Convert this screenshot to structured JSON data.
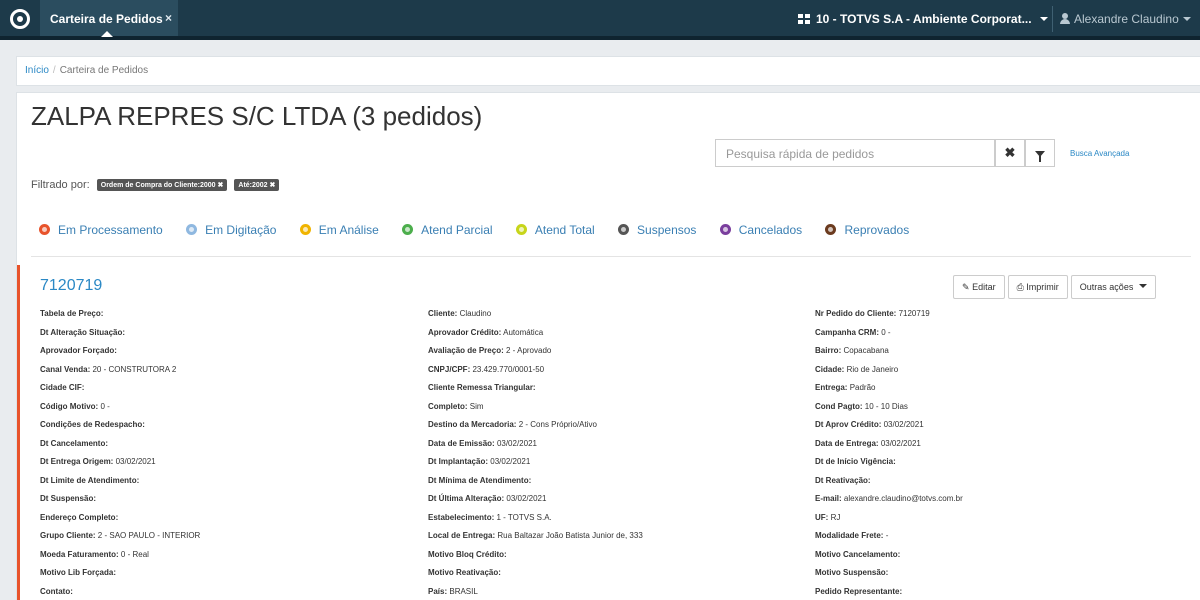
{
  "topbar": {
    "tab_label": "Carteira de Pedidos",
    "tab_close": "×",
    "company": "10 - TOTVS S.A - Ambiente Corporat...",
    "user": "Alexandre Claudino"
  },
  "breadcrumb": {
    "home": "Início",
    "separator": "/",
    "current": "Carteira de Pedidos"
  },
  "page": {
    "title": "ZALPA REPRES S/C LTDA (3 pedidos)",
    "search_placeholder": "Pesquisa rápida de pedidos",
    "clear_icon": "✖",
    "advanced_search": "Busca Avançada",
    "filter_label": "Filtrado por:",
    "filters": [
      "Ordem de Compra do Cliente:2000 ✖",
      "Até:2002 ✖"
    ]
  },
  "legend": [
    {
      "label": "Em Processamento",
      "color": "#e8532b"
    },
    {
      "label": "Em Digitação",
      "color": "#8fb8e0"
    },
    {
      "label": "Em Análise",
      "color": "#f0b400"
    },
    {
      "label": "Atend Parcial",
      "color": "#4cae4c"
    },
    {
      "label": "Atend Total",
      "color": "#c7d51a"
    },
    {
      "label": "Suspensos",
      "color": "#555555"
    },
    {
      "label": "Cancelados",
      "color": "#7a3e9d"
    },
    {
      "label": "Reprovados",
      "color": "#6b3b1f"
    }
  ],
  "order": {
    "id": "7120719",
    "edit_label": "Editar",
    "print_label": "Imprimir",
    "more_label": "Outras ações",
    "col1": [
      {
        "label": "Tabela de Preço:",
        "value": ""
      },
      {
        "label": "Dt Alteração Situação:",
        "value": ""
      },
      {
        "label": "Aprovador Forçado:",
        "value": ""
      },
      {
        "label": "Canal Venda:",
        "value": "20 - CONSTRUTORA 2"
      },
      {
        "label": "Cidade CIF:",
        "value": ""
      },
      {
        "label": "Código Motivo:",
        "value": "0 -"
      },
      {
        "label": "Condições de Redespacho:",
        "value": ""
      },
      {
        "label": "Dt Cancelamento:",
        "value": ""
      },
      {
        "label": "Dt Entrega Origem:",
        "value": "03/02/2021"
      },
      {
        "label": "Dt Limite de Atendimento:",
        "value": ""
      },
      {
        "label": "Dt Suspensão:",
        "value": ""
      },
      {
        "label": "Endereço Completo:",
        "value": ""
      },
      {
        "label": "Grupo Cliente:",
        "value": "2 - SAO PAULO - INTERIOR"
      },
      {
        "label": "Moeda Faturamento:",
        "value": "0 - Real"
      },
      {
        "label": "Motivo Lib Forçada:",
        "value": ""
      },
      {
        "label": "Contato:",
        "value": ""
      }
    ],
    "col2": [
      {
        "label": "Cliente:",
        "value": "Claudino"
      },
      {
        "label": "Aprovador Crédito:",
        "value": "Automática"
      },
      {
        "label": "Avaliação de Preço:",
        "value": "2 - Aprovado"
      },
      {
        "label": "CNPJ/CPF:",
        "value": "23.429.770/0001-50"
      },
      {
        "label": "Cliente Remessa Triangular:",
        "value": ""
      },
      {
        "label": "Completo:",
        "value": "Sim"
      },
      {
        "label": "Destino da Mercadoria:",
        "value": "2 - Cons Próprio/Ativo"
      },
      {
        "label": "Data de Emissão:",
        "value": "03/02/2021"
      },
      {
        "label": "Dt Implantação:",
        "value": "03/02/2021"
      },
      {
        "label": "Dt Mínima de Atendimento:",
        "value": ""
      },
      {
        "label": "Dt Última Alteração:",
        "value": "03/02/2021"
      },
      {
        "label": "Estabelecimento:",
        "value": "1 - TOTVS S.A."
      },
      {
        "label": "Local de Entrega:",
        "value": "Rua Baltazar João Batista Junior de, 333"
      },
      {
        "label": "Motivo Bloq Crédito:",
        "value": ""
      },
      {
        "label": "Motivo Reativação:",
        "value": ""
      },
      {
        "label": "País:",
        "value": "BRASIL"
      }
    ],
    "col3": [
      {
        "label": "Nr Pedido do Cliente:",
        "value": "7120719"
      },
      {
        "label": "Campanha CRM:",
        "value": "0 -"
      },
      {
        "label": "Bairro:",
        "value": "Copacabana"
      },
      {
        "label": "Cidade:",
        "value": "Rio de Janeiro"
      },
      {
        "label": "Entrega:",
        "value": "Padrão"
      },
      {
        "label": "Cond Pagto:",
        "value": "10 - 10 Dias"
      },
      {
        "label": "Dt Aprov Crédito:",
        "value": "03/02/2021"
      },
      {
        "label": "Data de Entrega:",
        "value": "03/02/2021"
      },
      {
        "label": "Dt de Início Vigência:",
        "value": ""
      },
      {
        "label": "Dt Reativação:",
        "value": ""
      },
      {
        "label": "E-mail:",
        "value": "alexandre.claudino@totvs.com.br"
      },
      {
        "label": "UF:",
        "value": "RJ"
      },
      {
        "label": "Modalidade Frete:",
        "value": "-"
      },
      {
        "label": "Motivo Cancelamento:",
        "value": ""
      },
      {
        "label": "Motivo Suspensão:",
        "value": ""
      },
      {
        "label": "Pedido Representante:",
        "value": ""
      }
    ]
  }
}
